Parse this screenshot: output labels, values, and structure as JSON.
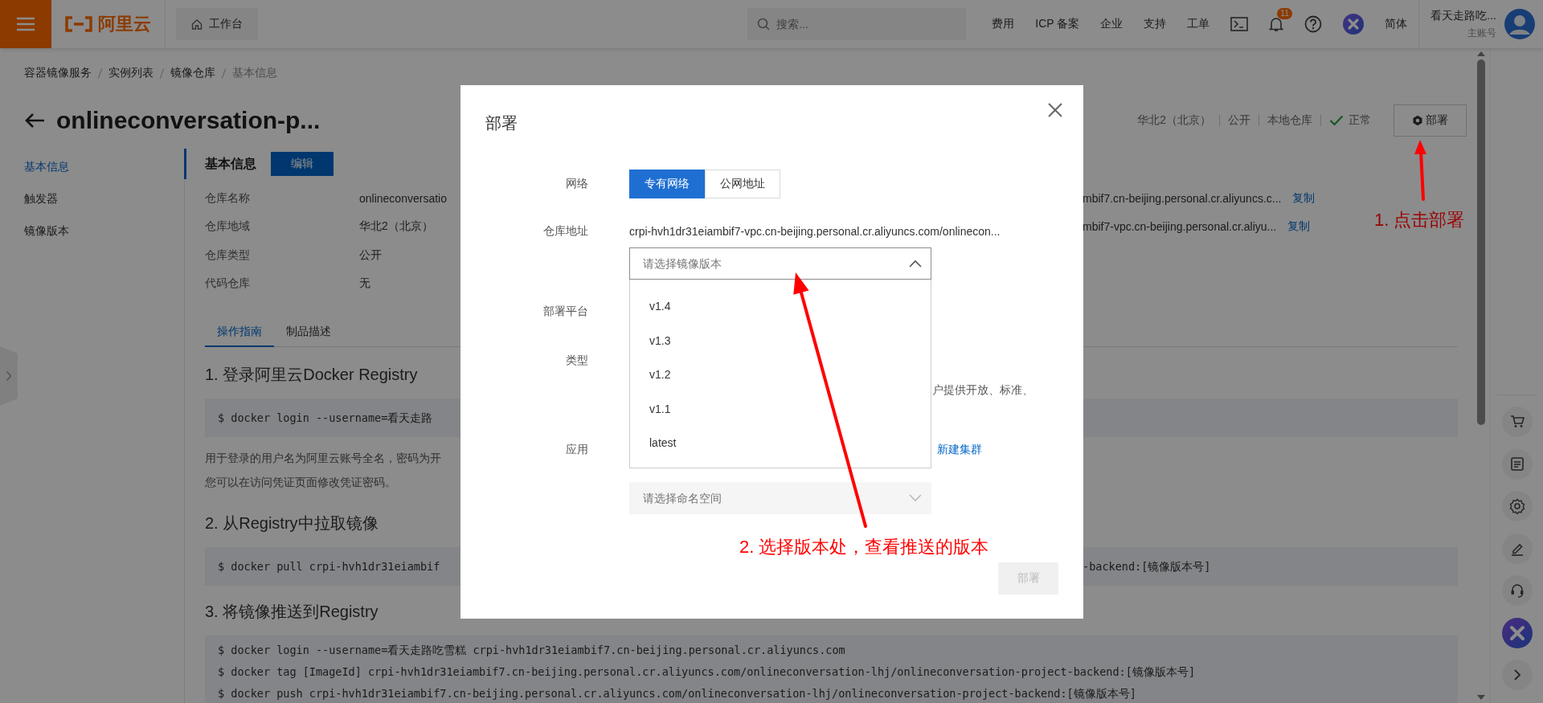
{
  "top_bar": {
    "logo_text": "阿里云",
    "workbench": "工作台",
    "search_placeholder": "搜索...",
    "nav": [
      "费用",
      "ICP 备案",
      "企业",
      "支持",
      "工单"
    ],
    "notification_count": "11",
    "language": "简体",
    "user_name": "看天走路吃...",
    "account_type": "主账号"
  },
  "breadcrumb": [
    "容器镜像服务",
    "实例列表",
    "镜像仓库",
    "基本信息"
  ],
  "header": {
    "title": "onlineconversation-p...",
    "meta": [
      "华北2（北京）",
      "公开",
      "本地仓库"
    ],
    "status": "正常",
    "deploy_button": "部署"
  },
  "sidebar": {
    "items": [
      {
        "label": "基本信息",
        "selected": true
      },
      {
        "label": "触发器",
        "selected": false
      },
      {
        "label": "镜像版本",
        "selected": false
      }
    ]
  },
  "basic_info": {
    "title": "基本信息",
    "edit_button": "编辑",
    "rows": [
      {
        "label": "仓库名称",
        "value": "onlineconversatio",
        "address": "mbif7.cn-beijing.personal.cr.aliyuncs.c...",
        "copy": "复制"
      },
      {
        "label": "仓库地域",
        "value": "华北2（北京）",
        "address": "mbif7-vpc.cn-beijing.personal.cr.aliyu...",
        "copy": "复制"
      },
      {
        "label": "仓库类型",
        "value": "公开"
      },
      {
        "label": "代码仓库",
        "value": "无"
      }
    ]
  },
  "guide_tabs": [
    {
      "label": "操作指南",
      "selected": true
    },
    {
      "label": "制品描述",
      "selected": false
    }
  ],
  "guide": [
    {
      "heading": "1. 登录阿里云Docker Registry",
      "code": [
        {
          "kind": "split",
          "left": "$ docker login --username=看天走路"
        }
      ],
      "notes": [
        "用于登录的用户名为阿里云账号全名，密码为开",
        "您可以在访问凭证页面修改凭证密码。"
      ]
    },
    {
      "heading": "2. 从Registry中拉取镜像",
      "code": [
        {
          "kind": "split",
          "left": "$ docker pull crpi-hvh1dr31eiambif",
          "right": "-backend:[镜像版本号]"
        }
      ]
    },
    {
      "heading": "3. 将镜像推送到Registry",
      "code": [
        {
          "kind": "full",
          "text": "$ docker login --username=看天走路吃雪糕 crpi-hvh1dr31eiambif7.cn-beijing.personal.cr.aliyuncs.com"
        },
        {
          "kind": "full",
          "text": "$ docker tag [ImageId] crpi-hvh1dr31eiambif7.cn-beijing.personal.cr.aliyuncs.com/onlineconversation-lhj/onlineconversation-project-backend:[镜像版本号]"
        },
        {
          "kind": "full",
          "text": "$ docker push crpi-hvh1dr31eiambif7.cn-beijing.personal.cr.aliyuncs.com/onlineconversation-lhj/onlineconversation-project-backend:[镜像版本号]"
        }
      ]
    }
  ],
  "modal": {
    "title": "部署",
    "network": {
      "label": "网络",
      "options": [
        {
          "label": "专有网络",
          "selected": true
        },
        {
          "label": "公网地址",
          "selected": false
        }
      ]
    },
    "address": {
      "label": "仓库地址",
      "value": "crpi-hvh1dr31eiambif7-vpc.cn-beijing.personal.cr.aliyuncs.com/onlinecon...",
      "version_select": {
        "placeholder": "请选择镜像版本",
        "expanded": true,
        "options": [
          "v1.4",
          "v1.3",
          "v1.2",
          "v1.1",
          "latest"
        ]
      }
    },
    "platform": {
      "label": "部署平台"
    },
    "type": {
      "label": "类型",
      "description": "户提供开放、标准、"
    },
    "app": {
      "label": "应用",
      "link": "新建集群",
      "namespace_select": {
        "placeholder": "请选择命名空间",
        "disabled": true
      }
    },
    "submit": {
      "label": "部署",
      "disabled": true
    }
  },
  "annotations": [
    {
      "text": "1. 点击部署"
    },
    {
      "text": "2. 选择版本处，查看推送的版本"
    }
  ]
}
